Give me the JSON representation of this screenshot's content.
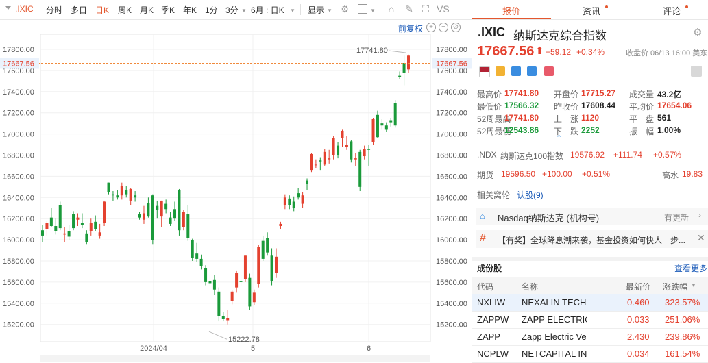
{
  "toolbar": {
    "symbol": ".IXIC",
    "periods": [
      "分时",
      "多日",
      "日K",
      "周K",
      "月K",
      "季K",
      "年K",
      "1分",
      "3分"
    ],
    "active_period": "日K",
    "range": "6月 : 日K",
    "display": "显示",
    "vs": "VS"
  },
  "chart": {
    "fuquan": "前复权",
    "current_price_label": "17667.56",
    "high_marker": "17741.80",
    "low_marker": "15222.78",
    "date_labels": [
      "2024/04",
      "5",
      "6"
    ]
  },
  "chart_data": {
    "type": "candlestick",
    "title": "",
    "ylim": [
      15100,
      17900
    ],
    "y_ticks": [
      "17800.00",
      "17600.00",
      "17400.00",
      "17200.00",
      "17000.00",
      "16800.00",
      "16600.00",
      "16400.00",
      "16200.00",
      "16000.00",
      "15800.00",
      "15600.00",
      "15400.00",
      "15200.00"
    ],
    "candles": [
      {
        "o": 16090,
        "h": 16140,
        "l": 15980,
        "c": 16040
      },
      {
        "o": 16100,
        "h": 16180,
        "l": 16040,
        "c": 16160
      },
      {
        "o": 16210,
        "h": 16300,
        "l": 16120,
        "c": 16130
      },
      {
        "o": 16130,
        "h": 16200,
        "l": 16050,
        "c": 16080
      },
      {
        "o": 16330,
        "h": 16360,
        "l": 16090,
        "c": 16110
      },
      {
        "o": 16050,
        "h": 16120,
        "l": 15980,
        "c": 16060
      },
      {
        "o": 16080,
        "h": 16140,
        "l": 16000,
        "c": 16030
      },
      {
        "o": 16240,
        "h": 16270,
        "l": 16090,
        "c": 16110
      },
      {
        "o": 16190,
        "h": 16250,
        "l": 16130,
        "c": 16210
      },
      {
        "o": 16160,
        "h": 16250,
        "l": 16110,
        "c": 16140
      },
      {
        "o": 16060,
        "h": 16090,
        "l": 15960,
        "c": 15980
      },
      {
        "o": 16080,
        "h": 16200,
        "l": 16040,
        "c": 16160
      },
      {
        "o": 16170,
        "h": 16230,
        "l": 16080,
        "c": 16100
      },
      {
        "o": 16040,
        "h": 16150,
        "l": 16010,
        "c": 16070
      },
      {
        "o": 16160,
        "h": 16370,
        "l": 16130,
        "c": 16360
      },
      {
        "o": 16540,
        "h": 16540,
        "l": 16430,
        "c": 16450
      },
      {
        "o": 16430,
        "h": 16460,
        "l": 16370,
        "c": 16420
      },
      {
        "o": 16420,
        "h": 16470,
        "l": 16380,
        "c": 16400
      },
      {
        "o": 16420,
        "h": 16540,
        "l": 16380,
        "c": 16510
      },
      {
        "o": 16470,
        "h": 16510,
        "l": 16400,
        "c": 16430
      },
      {
        "o": 16370,
        "h": 16490,
        "l": 16330,
        "c": 16480
      },
      {
        "o": 16420,
        "h": 16460,
        "l": 16360,
        "c": 16400
      },
      {
        "o": 16240,
        "h": 16260,
        "l": 16190,
        "c": 16210
      },
      {
        "o": 16190,
        "h": 16320,
        "l": 16150,
        "c": 16250
      },
      {
        "o": 16350,
        "h": 16400,
        "l": 16210,
        "c": 16220
      },
      {
        "o": 16420,
        "h": 16430,
        "l": 15960,
        "c": 16000
      },
      {
        "o": 16320,
        "h": 16370,
        "l": 16200,
        "c": 16280
      },
      {
        "o": 16220,
        "h": 16370,
        "l": 16120,
        "c": 16370
      },
      {
        "o": 16340,
        "h": 16380,
        "l": 16250,
        "c": 16290
      },
      {
        "o": 16210,
        "h": 16260,
        "l": 16130,
        "c": 16150
      },
      {
        "o": 16290,
        "h": 16360,
        "l": 16180,
        "c": 16200
      },
      {
        "o": 16470,
        "h": 16480,
        "l": 16040,
        "c": 16090
      },
      {
        "o": 16120,
        "h": 16280,
        "l": 16090,
        "c": 16260
      },
      {
        "o": 16240,
        "h": 16330,
        "l": 15990,
        "c": 16020
      },
      {
        "o": 16000,
        "h": 16010,
        "l": 15800,
        "c": 15830
      },
      {
        "o": 15870,
        "h": 15970,
        "l": 15790,
        "c": 15820
      },
      {
        "o": 15820,
        "h": 15860,
        "l": 15720,
        "c": 15750
      },
      {
        "o": 15730,
        "h": 15760,
        "l": 15570,
        "c": 15600
      },
      {
        "o": 15610,
        "h": 15670,
        "l": 15560,
        "c": 15590
      },
      {
        "o": 15620,
        "h": 15670,
        "l": 15480,
        "c": 15530
      },
      {
        "o": 15510,
        "h": 15550,
        "l": 15230,
        "c": 15280
      },
      {
        "o": 15280,
        "h": 15320,
        "l": 15230,
        "c": 15250
      },
      {
        "o": 15240,
        "h": 15340,
        "l": 15200,
        "c": 15260
      },
      {
        "o": 15420,
        "h": 15520,
        "l": 15390,
        "c": 15510
      },
      {
        "o": 15550,
        "h": 15710,
        "l": 15500,
        "c": 15690
      },
      {
        "o": 15610,
        "h": 15670,
        "l": 15560,
        "c": 15600
      },
      {
        "o": 15630,
        "h": 15850,
        "l": 15600,
        "c": 15850
      },
      {
        "o": 15640,
        "h": 15680,
        "l": 15340,
        "c": 15370
      },
      {
        "o": 15410,
        "h": 15530,
        "l": 15380,
        "c": 15500
      },
      {
        "o": 15580,
        "h": 15950,
        "l": 15550,
        "c": 15930
      },
      {
        "o": 15990,
        "h": 16040,
        "l": 15800,
        "c": 15820
      },
      {
        "o": 16020,
        "h": 16070,
        "l": 15850,
        "c": 15880
      },
      {
        "o": 15850,
        "h": 15920,
        "l": 15570,
        "c": 15610
      },
      {
        "o": 15690,
        "h": 15920,
        "l": 15640,
        "c": 15840
      },
      {
        "o": 16130,
        "h": 16170,
        "l": 16100,
        "c": 16150
      },
      {
        "o": 16330,
        "h": 16430,
        "l": 16290,
        "c": 16400
      },
      {
        "o": 16390,
        "h": 16420,
        "l": 16290,
        "c": 16330
      },
      {
        "o": 16360,
        "h": 16410,
        "l": 16270,
        "c": 16300
      },
      {
        "o": 16440,
        "h": 16490,
        "l": 16380,
        "c": 16400
      },
      {
        "o": 16340,
        "h": 16450,
        "l": 16300,
        "c": 16420
      },
      {
        "o": 16560,
        "h": 16580,
        "l": 16470,
        "c": 16530
      },
      {
        "o": 16660,
        "h": 16820,
        "l": 16640,
        "c": 16810
      },
      {
        "o": 16710,
        "h": 16760,
        "l": 16680,
        "c": 16710
      },
      {
        "o": 16750,
        "h": 16780,
        "l": 16660,
        "c": 16740
      },
      {
        "o": 16710,
        "h": 16860,
        "l": 16700,
        "c": 16830
      },
      {
        "o": 16760,
        "h": 16850,
        "l": 16720,
        "c": 16770
      },
      {
        "o": 16800,
        "h": 16980,
        "l": 16760,
        "c": 16960
      },
      {
        "o": 16890,
        "h": 16920,
        "l": 16770,
        "c": 16800
      },
      {
        "o": 16960,
        "h": 17040,
        "l": 16880,
        "c": 17030
      },
      {
        "o": 16880,
        "h": 16980,
        "l": 16850,
        "c": 16900
      },
      {
        "o": 16930,
        "h": 16940,
        "l": 16730,
        "c": 16760
      },
      {
        "o": 16760,
        "h": 16820,
        "l": 16700,
        "c": 16770
      },
      {
        "o": 16830,
        "h": 16850,
        "l": 16460,
        "c": 16500
      },
      {
        "o": 16790,
        "h": 16890,
        "l": 16760,
        "c": 16860
      },
      {
        "o": 16860,
        "h": 16900,
        "l": 16700,
        "c": 16850
      },
      {
        "o": 16920,
        "h": 17150,
        "l": 16900,
        "c": 17140
      },
      {
        "o": 17180,
        "h": 17220,
        "l": 16960,
        "c": 16970
      },
      {
        "o": 17100,
        "h": 17140,
        "l": 17040,
        "c": 17080
      },
      {
        "o": 17080,
        "h": 17110,
        "l": 17020,
        "c": 17040
      },
      {
        "o": 17130,
        "h": 17150,
        "l": 17070,
        "c": 17110
      },
      {
        "o": 17290,
        "h": 17320,
        "l": 17060,
        "c": 17080
      },
      {
        "o": 17550,
        "h": 17590,
        "l": 17520,
        "c": 17540
      },
      {
        "o": 17670,
        "h": 17740,
        "l": 17460,
        "c": 17580
      },
      {
        "o": 17610,
        "h": 17750,
        "l": 17580,
        "c": 17740
      }
    ]
  },
  "header": {
    "tabs": [
      "报价",
      "资讯",
      "评论"
    ],
    "symbol": ".IXIC",
    "name": "纳斯达克综合指数",
    "price": "17667.56",
    "change": "+59.12",
    "change_pct": "+0.34%",
    "status": "收盘价 06/13 16:00 美东"
  },
  "stats": {
    "high_label": "最高价",
    "high": "17741.80",
    "open_label": "开盘价",
    "open": "17715.27",
    "vol_label": "成交量",
    "vol": "43.2亿",
    "low_label": "最低价",
    "low": "17566.32",
    "prev_label": "昨收价",
    "prev": "17608.44",
    "avg_label": "平均价",
    "avg": "17654.06",
    "w52h_label": "52周最高",
    "w52h": "17741.80",
    "up_label": "上　涨",
    "up": "1120",
    "flat_label": "平　盘",
    "flat": "561",
    "w52l_label": "52周最低",
    "w52l": "12543.86",
    "down_label": "下　跌",
    "down": "2252",
    "amp_label": "振　幅",
    "amp": "1.00%"
  },
  "related": {
    "ndx_symbol": ".NDX",
    "ndx_name": "纳斯达克100指数",
    "ndx_price": "19576.92",
    "ndx_change": "+111.74",
    "ndx_pct": "+0.57%",
    "futures_label": "期货",
    "futures_price": "19596.50",
    "futures_change": "+100.00",
    "futures_pct": "+0.51%",
    "gaoshui_label": "高水",
    "gaoshui_value": "19.83",
    "warrants_label": "相关窝轮",
    "warrants_link": "认股(9)"
  },
  "news": {
    "org_title": "Nasdaq纳斯达克 (机构号)",
    "org_update": "有更新",
    "promo": "【有奖】全球降息潮来袭，基金投资如何快人一步..."
  },
  "components": {
    "title": "成份股",
    "more": "查看更多",
    "headers": [
      "代码",
      "名称",
      "最新价",
      "涨跌幅"
    ],
    "rows": [
      {
        "code": "NXLIW",
        "name": "NEXALIN TECH",
        "price": "0.460",
        "pct": "323.57%"
      },
      {
        "code": "ZAPPW",
        "name": "ZAPP ELECTRIC",
        "price": "0.033",
        "pct": "251.06%"
      },
      {
        "code": "ZAPP",
        "name": "Zapp Electric Ve",
        "price": "2.430",
        "pct": "239.86%"
      },
      {
        "code": "NCPLW",
        "name": "NETCAPITAL IN",
        "price": "0.034",
        "pct": "161.54%"
      }
    ]
  },
  "colors": {
    "up": "#e4412f",
    "down": "#1a9a3a",
    "accent": "#e4572e",
    "link": "#1a5ab8"
  }
}
